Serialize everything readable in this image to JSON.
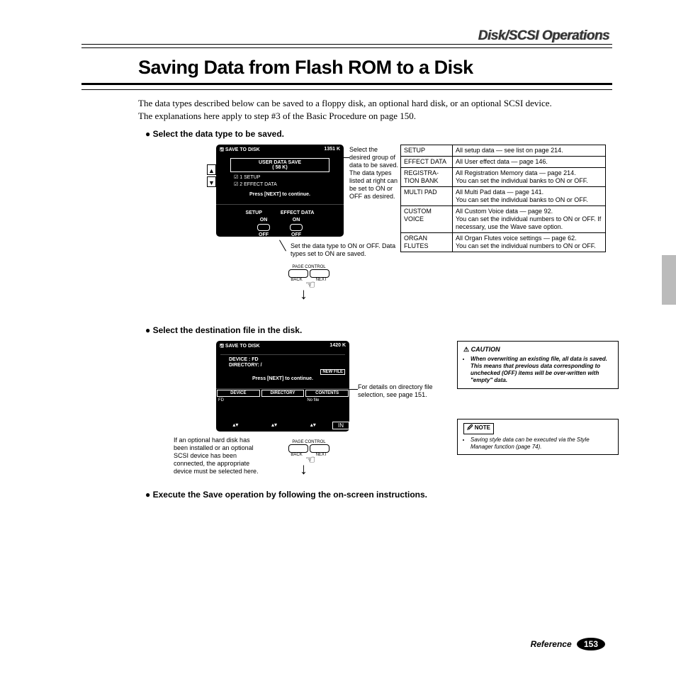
{
  "header": {
    "run": "Disk/SCSI Operations"
  },
  "title": "Saving Data from Flash ROM to a Disk",
  "intro": {
    "p1": "The data types described below can be saved to a floppy disk, an optional hard disk, or an optional SCSI device.",
    "p2": "The explanations here apply to step #3 of the Basic Procedure on page 150."
  },
  "bullets": {
    "b1": "Select the data type to be saved.",
    "b2": "Select the destination file in the disk.",
    "b3": "Execute the Save operation by following the on-screen instructions."
  },
  "lcd1": {
    "title": "SAVE TO DISK",
    "free": "1351 K",
    "userbox1": "USER DATA SAVE",
    "userbox2": "(     58 K)",
    "row1": "1 SETUP",
    "row2": "2 EFFECT DATA",
    "press": "Press [NEXT] to continue.",
    "btn1": "SETUP",
    "btn2": "EFFECT DATA",
    "on": "ON",
    "off": "OFF"
  },
  "captions": {
    "c1": "Select the desired group of data to be saved. The data types listed at right can be set to ON or OFF as desired.",
    "c2": "Set the data type to ON or OFF. Data types set to ON are saved.",
    "c3": "For details on directory file selection, see page 151.",
    "c4": "If an optional hard disk has been installed or an optional SCSI device has been connected, the appropriate device must be selected here."
  },
  "pagectrl": {
    "label": "PAGE CONTROL",
    "back": "BACK",
    "next": "NEXT"
  },
  "table": {
    "r1a": "SETUP",
    "r1b": "All setup data — see list on page 214.",
    "r2a": "EFFECT DATA",
    "r2b": "All User effect data — page 146.",
    "r3a": "REGISTRA-TION BANK",
    "r3b": "All Registration Memory data — page 214.\nYou can set the individual banks to ON or OFF.",
    "r4a": "MULTI PAD",
    "r4b": "All Multi Pad data — page 141.\nYou can set the individual banks to ON or OFF.",
    "r5a": "CUSTOM VOICE",
    "r5b": "All Custom Voice data — page 92.\nYou can set the individual numbers to ON or OFF. If necessary, use the Wave save option.",
    "r6a": "ORGAN FLUTES",
    "r6b": "All Organ Flutes voice settings — page 62.\nYou can set the individual numbers to ON or OFF."
  },
  "lcd2": {
    "title": "SAVE TO DISK",
    "free": "1420 K",
    "device": "DEVICE : FD",
    "dir": "DIRECTORY: /",
    "newfile": "NEW FILE",
    "press": "Press [NEXT] to continue.",
    "col1": "DEVICE",
    "col2": "DIRECTORY",
    "col3": "CONTENTS",
    "fd": "FD",
    "nofile": "No file",
    "in": "IN"
  },
  "caution": {
    "hd": "CAUTION",
    "txt": "When overwriting an existing file, all data is saved. This means that previous data corresponding to unchecked (OFF) items will be over-written with \"empty\" data."
  },
  "notebox": {
    "hd": "NOTE",
    "txt": "Saving style data can be executed via the Style Manager function (page 74)."
  },
  "footer": {
    "ref": "Reference",
    "page": "153"
  }
}
